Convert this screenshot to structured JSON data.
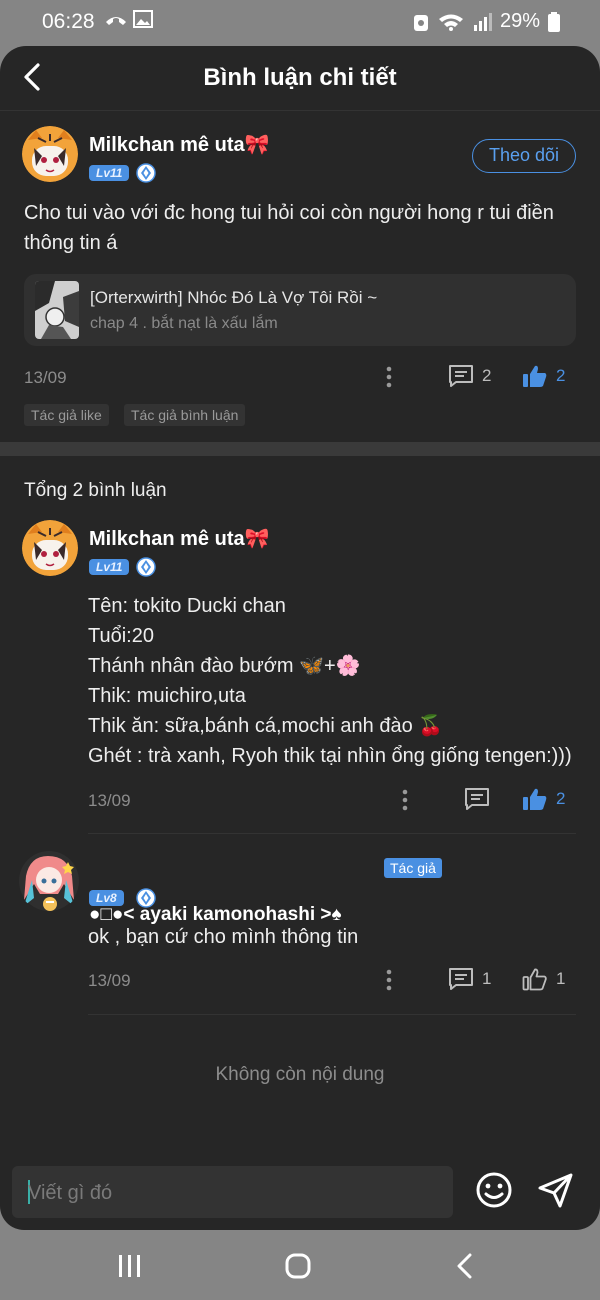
{
  "status_bar": {
    "time": "06:28",
    "battery": "29%"
  },
  "header": {
    "title": "Bình luận chi tiết"
  },
  "post": {
    "user": "Milkchan mê uta🎀",
    "level": "Lv11",
    "follow_label": "Theo dõi",
    "text": "Cho tui vào với đc hong tui hỏi coi còn người hong r tui điền thông tin á",
    "reference": {
      "title": "[Orterxwirth] Nhóc Đó Là Vợ Tôi Rồi ~",
      "subtitle": "chap 4 . bắt nạt là xấu lắm"
    },
    "date": "13/09",
    "reply_count": "2",
    "like_count": "2",
    "tags": [
      "Tác giả like",
      "Tác giả bình luận"
    ]
  },
  "replies_section": {
    "total_label": "Tổng 2 bình luận",
    "replies": [
      {
        "user": "Milkchan mê uta🎀",
        "level": "Lv11",
        "lines": [
          "Tên: tokito Ducki chan",
          "Tuổi:20",
          "Thánh nhân đào bướm 🦋+🌸",
          "Thik: muichiro,uta",
          "Thik ăn: sữa,bánh cá,mochi anh đào 🍒",
          "Ghét : trà xanh, Ryoh thik tại nhìn ổng giống tengen:)))"
        ],
        "date": "13/09",
        "like_count": "2"
      },
      {
        "user": "●□●< ayaki kamonohashi >♠",
        "author_badge": "Tác giả",
        "level": "Lv8",
        "text": "ok , bạn cứ cho mình thông tin",
        "date": "13/09",
        "reply_count": "1",
        "like_count": "1"
      }
    ],
    "end_label": "Không còn nội dung"
  },
  "composer": {
    "placeholder": "Viết gì đó"
  },
  "colors": {
    "background": "#262626",
    "accent": "#4a90e2"
  }
}
